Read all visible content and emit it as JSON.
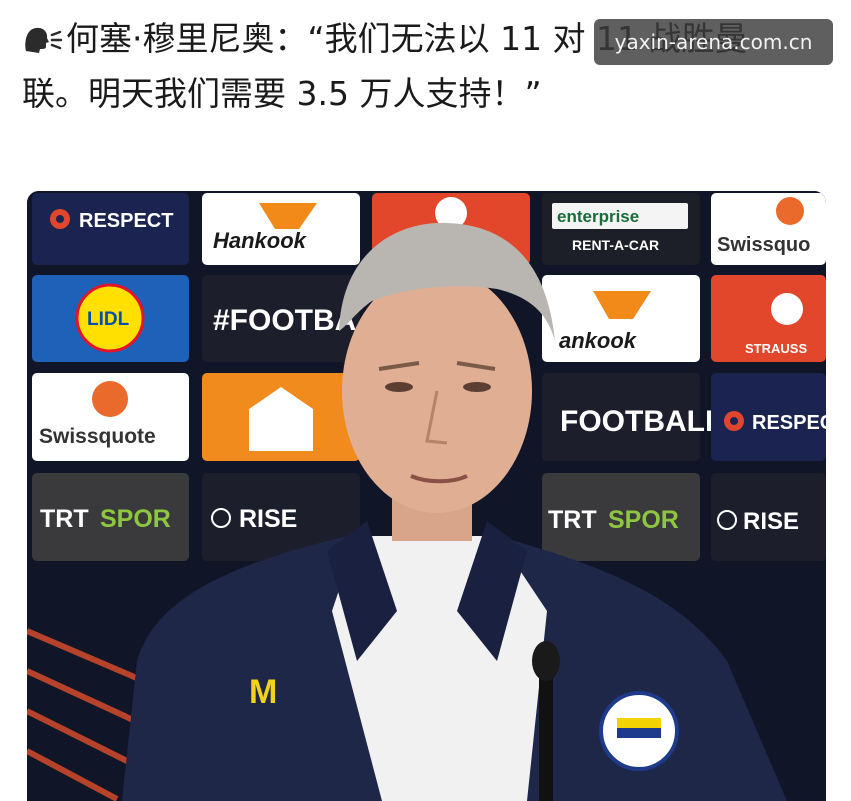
{
  "post": {
    "line1": "何塞·穆里尼奥：“我们无法以 11 对 11 战胜曼",
    "line2": "联。明天我们需要 3.5 万人支持！”"
  },
  "watermark": {
    "text": "yaxin-arena.com.cn"
  },
  "sponsors": {
    "respect": "RESPECT",
    "respect_cut": "RESPEC",
    "hankook": "Hankook",
    "hankook_cut": "ankook",
    "enterprise": "enterprise",
    "rentacar": "RENT-A-CAR",
    "swissquote": "Swissquote",
    "swissquote_cut": "Swissquo",
    "lidl": "LIDL",
    "football": "#FOOTBALL",
    "football_cut1": "#FOOTBA",
    "football_cut2": "FOOTBALL",
    "strauss": "STRAUSS",
    "trtspor_a": "TRT",
    "trtspor_b": "SPOR",
    "rise": "RISE"
  }
}
